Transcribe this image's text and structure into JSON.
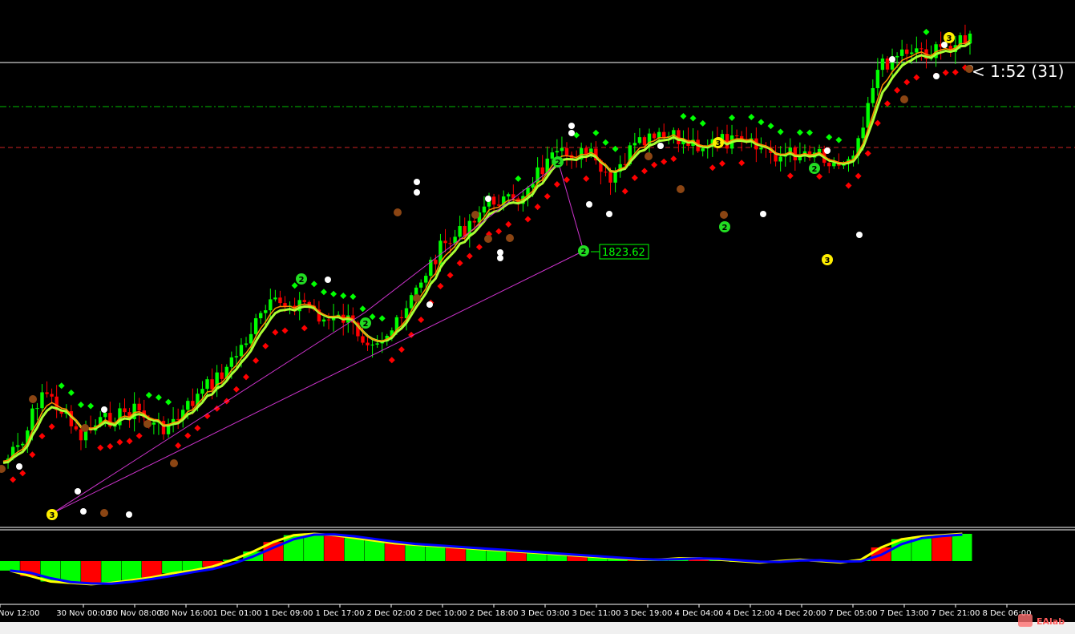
{
  "timer": {
    "label": "< 1:52 (31)"
  },
  "price_label": {
    "value": "1823.62",
    "pivot": "2"
  },
  "watermark": {
    "text": "EAlab"
  },
  "colors": {
    "background": "#000000",
    "bull": "#00ff00",
    "bear": "#ff0000",
    "ma_fast": "#ff8c00",
    "ma_slow": "#aaff33",
    "trend_line": "#cc33cc",
    "dot_white": "#ffffff",
    "dot_brown": "#8b4513",
    "pivot_green": "#22dd22",
    "pivot_yellow": "#ffee00",
    "level_green": "#00bb00",
    "level_red": "#cc2222",
    "histo_yellow": "#ffff00",
    "histo_blue": "#0000ff"
  },
  "chart_data": [
    {
      "type": "candlestick",
      "title": "",
      "x_tick_labels": [
        "Nov 12:00",
        "30 Nov 00:00",
        "30 Nov 08:00",
        "30 Nov 16:00",
        "1 Dec 01:00",
        "1 Dec 09:00",
        "1 Dec 17:00",
        "2 Dec 02:00",
        "2 Dec 10:00",
        "2 Dec 18:00",
        "3 Dec 03:00",
        "3 Dec 11:00",
        "3 Dec 19:00",
        "4 Dec 04:00",
        "4 Dec 12:00",
        "4 Dec 20:00",
        "7 Dec 05:00",
        "7 Dec 13:00",
        "7 Dec 21:00",
        "8 Dec 06:00"
      ],
      "trend_line_value": 1823.62,
      "pivot_markers": [
        {
          "label": "3",
          "color": "yellow"
        },
        {
          "label": "2",
          "color": "green"
        },
        {
          "label": "2",
          "color": "green"
        },
        {
          "label": "2",
          "color": "green"
        },
        {
          "label": "2",
          "color": "green"
        },
        {
          "label": "3",
          "color": "yellow"
        },
        {
          "label": "2",
          "color": "green"
        },
        {
          "label": "2",
          "color": "green"
        },
        {
          "label": "3",
          "color": "yellow"
        },
        {
          "label": "3",
          "color": "yellow"
        }
      ],
      "horizontal_levels": [
        "white solid (current price)",
        "green dash-dot",
        "red dashed"
      ],
      "close_path_approx": [
        0.52,
        0.56,
        0.71,
        0.66,
        0.58,
        0.62,
        0.64,
        0.66,
        0.61,
        0.62,
        0.68,
        0.73,
        0.78,
        0.86,
        0.93,
        0.94,
        0.94,
        0.89,
        0.9,
        0.85,
        0.85,
        0.89,
        1.0,
        1.08,
        1.12,
        1.18,
        1.22,
        1.2,
        1.28,
        1.32,
        1.34,
        1.33,
        1.25,
        1.34,
        1.37,
        1.38,
        1.37,
        1.36,
        1.37,
        1.36,
        1.35,
        1.33,
        1.34,
        1.35,
        1.3,
        1.36,
        1.55,
        1.6,
        1.62,
        1.6,
        1.63,
        1.64
      ]
    },
    {
      "type": "bar",
      "title": "",
      "note": "oscillator histogram with yellow and blue signal lines",
      "values": [
        -0.35,
        -0.55,
        -0.75,
        -0.8,
        -0.85,
        -0.8,
        -0.7,
        -0.6,
        -0.45,
        -0.35,
        -0.2,
        0.05,
        0.35,
        0.7,
        0.95,
        1.0,
        0.95,
        0.85,
        0.75,
        0.65,
        0.6,
        0.55,
        0.5,
        0.45,
        0.4,
        0.35,
        0.3,
        0.25,
        0.2,
        0.15,
        0.1,
        0.05,
        0.05,
        0.1,
        0.1,
        0.05,
        0.0,
        -0.05,
        0.0,
        0.05,
        0.0,
        -0.05,
        0.05,
        0.5,
        0.8,
        0.9,
        0.95,
        1.0
      ]
    }
  ]
}
